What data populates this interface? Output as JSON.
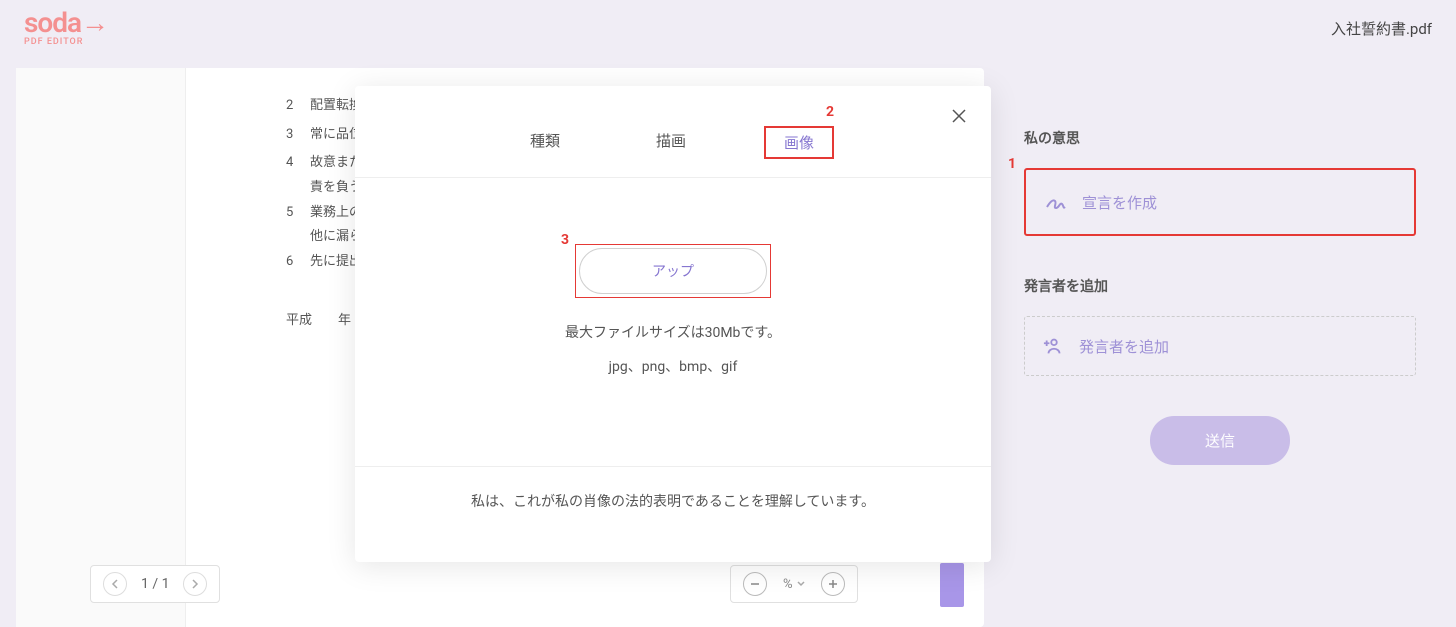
{
  "header": {
    "logo_main": "soda",
    "logo_arrow": "→",
    "logo_sub": "PDF EDITOR",
    "filename": "入社誓約書.pdf"
  },
  "document": {
    "lines": [
      {
        "num": "2",
        "text": "配置転換、"
      },
      {
        "num": "3",
        "text": "常に品位を"
      },
      {
        "num": "4",
        "text": "故意または"
      },
      {
        "num": "",
        "text": "責を負うこと"
      },
      {
        "num": "5",
        "text": "業務上の機"
      },
      {
        "num": "",
        "text": "他に漏らさず"
      },
      {
        "num": "6",
        "text": "先に提出し"
      }
    ],
    "date_line": "平成　　年"
  },
  "sidebar": {
    "intention_title": "私の意思",
    "create_declaration": "宣言を作成",
    "add_speaker_title": "発言者を追加",
    "add_speaker_label": "発言者を追加",
    "send": "送信"
  },
  "modal": {
    "tabs": {
      "type": "種類",
      "draw": "描画",
      "image": "画像"
    },
    "upload": "アップ",
    "max_size": "最大ファイルサイズは30Mbです。",
    "formats": "jpg、png、bmp、gif",
    "disclaimer": "私は、これが私の肖像の法的表明であることを理解しています。"
  },
  "pager": {
    "current": "1",
    "total": "1"
  },
  "zoom": {
    "percent": "%"
  },
  "callouts": {
    "one": "1",
    "two": "2",
    "three": "3"
  }
}
